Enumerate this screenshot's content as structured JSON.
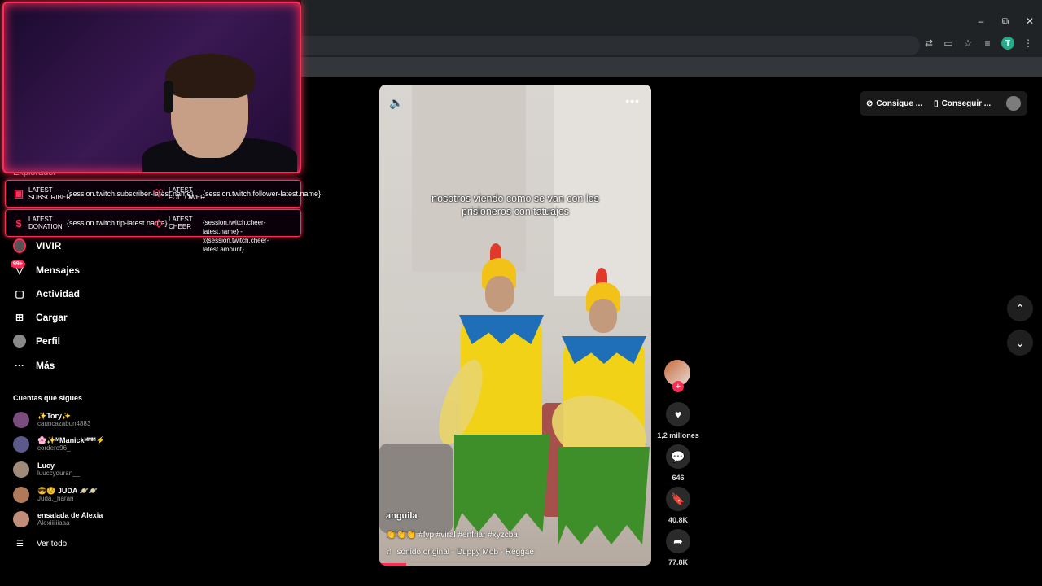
{
  "window_controls": {
    "minimize": "–",
    "restore": "⧉",
    "close": "✕"
  },
  "profile_initial": "T",
  "overlay": {
    "subscriber_label": "LATEST\nSUBSCRIBER",
    "subscriber_value": "{session.twitch.subscriber-latest.name}",
    "follower_label": "LATEST\nFOLLOWER",
    "follower_value": "{session.twitch.follower-latest.name}",
    "donation_label": "LATEST\nDONATION",
    "donation_value": "{session.twitch.tip-latest.name}",
    "cheer_label": "LATEST\nCHEER",
    "cheer_value": "{session.twitch.cheer-latest.name} - x{session.twitch.cheer-latest.amount}"
  },
  "sidebar": {
    "explore": "Explorador",
    "items": [
      {
        "label": "VIVIR",
        "icon": "live-avatar-icon"
      },
      {
        "label": "Mensajes",
        "icon": "messages-icon"
      },
      {
        "label": "Actividad",
        "icon": "activity-icon"
      },
      {
        "label": "Cargar",
        "icon": "upload-icon"
      },
      {
        "label": "Perfil",
        "icon": "profile-icon"
      },
      {
        "label": "Más",
        "icon": "more-icon"
      }
    ],
    "messages_badge": "99+",
    "following_title": "Cuentas que sigues",
    "accounts": [
      {
        "name": "✨Tory✨",
        "user": "cauncazabun4883"
      },
      {
        "name": "🌸✨ᴹManickᴹᴹᴹ⚡",
        "user": "cordero96_"
      },
      {
        "name": "Lucy",
        "user": "luuccyduran__"
      },
      {
        "name": "😎😚 JUDA 🪐🪐",
        "user": "Juda._harari"
      },
      {
        "name": "ensalada de Alexia",
        "user": "Alexiiiiiiaaa"
      }
    ],
    "see_all": "Ver todo"
  },
  "video": {
    "caption": "nosotros viendo como se van con los prisioneros con tatuajes",
    "author": "anguila",
    "description": "👏👏👏 #fyp #viral #enfriar #xyzcba",
    "music": "sonido original - Duppy Mob - Reggae",
    "progress_fraction": 0.1
  },
  "actions": {
    "likes": "1,2 millones",
    "comments": "646",
    "saves": "40.8K",
    "shares": "77.8K"
  },
  "top_buttons": {
    "get_coins": "Consigue ...",
    "get_app": "Conseguir ..."
  }
}
